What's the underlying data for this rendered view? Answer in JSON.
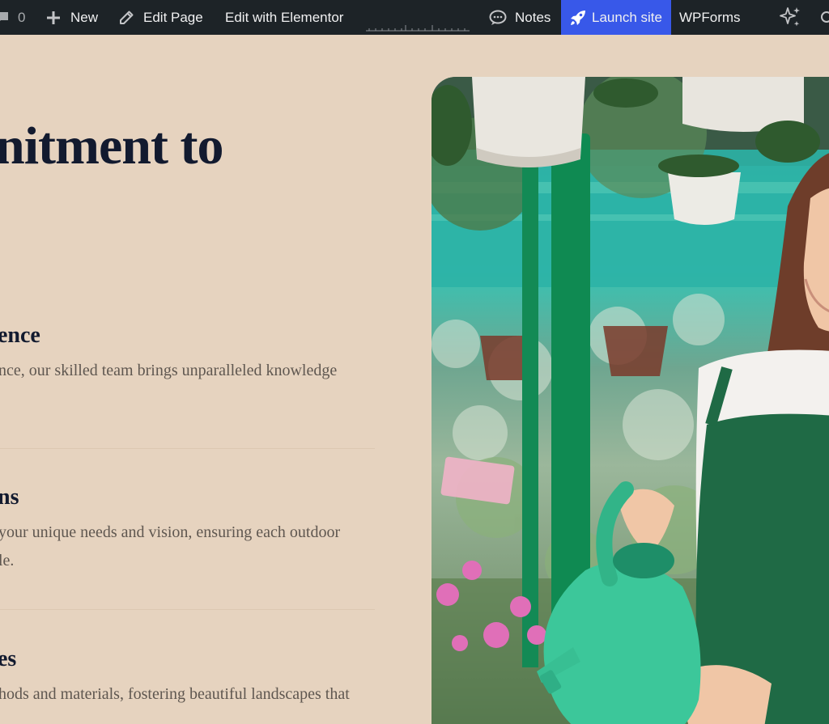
{
  "adminbar": {
    "comments_count": "0",
    "new_label": "New",
    "edit_page_label": "Edit Page",
    "edit_elementor_label": "Edit with Elementor",
    "notes_label": "Notes",
    "launch_label": "Launch site",
    "wpforms_label": "WPForms",
    "launch_bg": "#3858e9",
    "bar_bg": "#1d2327",
    "icons": {
      "comments": "comment-bubble-icon",
      "new": "plus-icon",
      "edit": "pencil-icon",
      "notes": "speech-bubble-icon",
      "launch": "rocket-icon",
      "ai": "sparkles-icon",
      "search": "search-icon"
    }
  },
  "content": {
    "heading": "nitment to",
    "features": [
      {
        "title": "ence",
        "lines": [
          "nce, our skilled team brings unparalleled knowledge"
        ]
      },
      {
        "title": "ns",
        "lines": [
          " your unique needs and vision, ensuring each outdoor",
          "le."
        ]
      },
      {
        "title": "es",
        "lines": [
          "hods and materials, fostering beautiful landscapes that"
        ]
      }
    ],
    "page_bg": "#e6d3bf",
    "heading_color": "#121a2f",
    "body_text_color": "#5f5750"
  },
  "hero_image": {
    "description_icon": "gardener-photo",
    "accent_apron": "#1f6a45",
    "accent_can": "#3cc79a"
  }
}
